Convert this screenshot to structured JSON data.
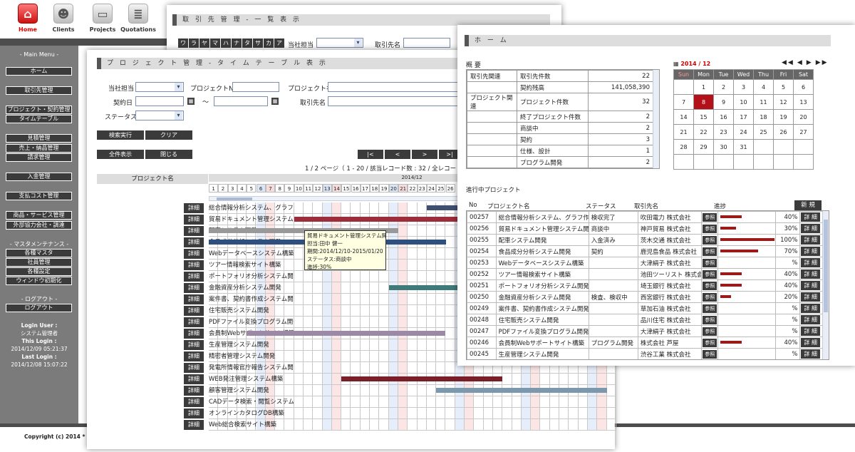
{
  "nav": [
    {
      "label": "Home",
      "icon": "home-icon"
    },
    {
      "label": "Clients",
      "icon": "person-icon"
    },
    {
      "label": "Projects",
      "icon": "folder-icon"
    },
    {
      "label": "Quotations",
      "icon": "document-icon"
    }
  ],
  "sidebar": {
    "main_menu_title": "- Main Menu -",
    "items": [
      "ホーム",
      "取引先管理",
      "プロジェクト・契約管理",
      "タイムテーブル",
      "見積管理",
      "売上・納品管理",
      "請求管理",
      "入金管理",
      "支払コスト管理",
      "商品・サービス管理",
      "外部協力会社・調達"
    ],
    "master_title": "- マスタメンテナンス -",
    "master_items": [
      "各種マスタ",
      "社員管理",
      "各種設定",
      "ウィンドウ初期化"
    ],
    "logout_title": "- ログアウト -",
    "logout_label": "ログアウト",
    "login_user_label": "Login User :",
    "login_user": "システム管理者",
    "this_login_label": "This Login :",
    "this_login": "2014/12/09 05:21:37",
    "last_login_label": "Last Login :",
    "last_login": "2014/12/08 15:07:22"
  },
  "footer": "Copyright (c) 2014 * di",
  "client_window": {
    "title": "取 引 先 管 理 - 一 覧 表 示",
    "kana": [
      "ワ",
      "ラ",
      "ヤ",
      "マ",
      "ハ",
      "ナ",
      "タ",
      "サ",
      "カ",
      "ア"
    ],
    "staff_label": "当社担当",
    "client_label": "取引先名"
  },
  "timetable": {
    "title": "プ ロ ジ ェ ク ト 管 理 - タ イ ム テ ー ブ ル 表 示",
    "filters": {
      "staff": "当社担当",
      "project_no": "プロジェクトNo",
      "project_name": "プロジェクト名",
      "contract_date": "契約日",
      "tilde": "～",
      "client": "取引先名",
      "status": "ステータス"
    },
    "search_label": "検索実行",
    "clear_label": "クリア",
    "show_all_label": "全件表示",
    "close_label": "閉じる",
    "pager": [
      "|<",
      "<",
      ">",
      ">|"
    ],
    "page_info": "1 / 2 ページ（ 1 - 20 / 該当レコード数 : 32 / 全レコード数",
    "col_project": "プロジェクト名",
    "month": "2014/12",
    "days": [
      "1",
      "2",
      "3",
      "4",
      "5",
      "6",
      "7",
      "8",
      "9",
      "10",
      "11",
      "12",
      "13",
      "14",
      "15",
      "16",
      "17",
      "18",
      "19",
      "20",
      "21",
      "22",
      "23",
      "24",
      "25",
      "26"
    ],
    "detail_label": "詳細",
    "projects": [
      "総合情報分析システム、グラフ作",
      "貿易ドキュメント管理システム開発",
      "配車システム開発",
      "食品成分分析システム開発",
      "Webデータベースシステム構築",
      "ツアー情報検索サイト構築",
      "ポートフォリオ分析システム開発",
      "金融資産分析システム開発",
      "案件書、契約書作成システム開発",
      "住宅販売システム開発",
      "PDFファイル変換プログラム開発",
      "会員制Webサポートサイト構築",
      "生産管理システム開発",
      "精密者管理システム開発",
      "発電所情報官庁報告システム開",
      "WEB発注管理システム構築",
      "顧客管理システム開発",
      "CADデータ検索・閲覧システム開",
      "オンラインカタログDB構築",
      "Web総合検索サイト構築"
    ],
    "tooltip": [
      "貿易ドキュメント管理システム開発",
      "担当:田中 健一",
      "期間:2014/12/10-2015/01/20",
      "ステータス:商談中",
      "進捗:30%"
    ]
  },
  "home": {
    "title": "ホ ー ム",
    "summary_title": "概 要",
    "summary": [
      {
        "group": "取引先関連",
        "label": "取引先件数",
        "value": "22"
      },
      {
        "group": "",
        "label": "契約残高",
        "value": "141,058,390"
      },
      {
        "group": "プロジェクト関連",
        "label": "プロジェクト件数",
        "value": "32"
      },
      {
        "group": "",
        "label": "終了プロジェクト件数",
        "value": "2"
      },
      {
        "group": "",
        "label": "商談中",
        "value": "2"
      },
      {
        "group": "",
        "label": "契約",
        "value": "3"
      },
      {
        "group": "",
        "label": "仕様、設計",
        "value": "1"
      },
      {
        "group": "",
        "label": "プログラム開発",
        "value": "2"
      },
      {
        "group": "",
        "label": "検査、検収中",
        "value": ""
      }
    ],
    "calendar": {
      "month": "2014 / 12",
      "nav": [
        "◀◀",
        "◀",
        "▶",
        "▶▶"
      ],
      "weekdays": [
        "Sun",
        "Mon",
        "Tue",
        "Wed",
        "Thu",
        "Fri",
        "Sat"
      ],
      "weeks": [
        [
          "",
          "1",
          "2",
          "3",
          "4",
          "5",
          "6"
        ],
        [
          "7",
          "8",
          "9",
          "10",
          "11",
          "12",
          "13"
        ],
        [
          "14",
          "15",
          "16",
          "17",
          "18",
          "19",
          "20"
        ],
        [
          "21",
          "22",
          "23",
          "24",
          "25",
          "26",
          "27"
        ],
        [
          "28",
          "29",
          "30",
          "31",
          "",
          "",
          ""
        ],
        [
          "",
          "",
          "",
          "",
          "",
          "",
          ""
        ]
      ],
      "today": "8"
    },
    "progress_title": "進行中プロジェクト",
    "cols": {
      "no": "No",
      "name": "プロジェクト名",
      "status": "ステータス",
      "client": "取引先名",
      "progress": "進捗",
      "new": "新 規"
    },
    "ref_label": "参照",
    "detail_label": "詳 細",
    "rows": [
      {
        "no": "00257",
        "name": "総合情報分析システム、グラフ作",
        "status": "検収完了",
        "client": "吹田電力 株式会社",
        "pct": "40%",
        "p": 40
      },
      {
        "no": "00256",
        "name": "貿易ドキュメント管理システム開",
        "status": "商談中",
        "client": "神戸貿易 株式会社",
        "pct": "30%",
        "p": 30
      },
      {
        "no": "00255",
        "name": "配車システム開発",
        "status": "入金済み",
        "client": "茨木交通 株式会社",
        "pct": "100%",
        "p": 100
      },
      {
        "no": "00254",
        "name": "食品成分分析システム開発",
        "status": "契約",
        "client": "鹿児島食品 株式会社",
        "pct": "70%",
        "p": 70
      },
      {
        "no": "00253",
        "name": "Webデータベースシステム構築",
        "status": "",
        "client": "大津絹子 株式会社",
        "pct": "%",
        "p": 0
      },
      {
        "no": "00252",
        "name": "ツアー情報検索サイト構築",
        "status": "",
        "client": "池田ツーリスト 株式会社",
        "pct": "40%",
        "p": 40
      },
      {
        "no": "00251",
        "name": "ポートフォリオ分析システム開発",
        "status": "",
        "client": "埼玉銀行 株式会社",
        "pct": "40%",
        "p": 40
      },
      {
        "no": "00250",
        "name": "金融資産分析システム開発",
        "status": "検査、検収中",
        "client": "西宮銀行 株式会社",
        "pct": "20%",
        "p": 20
      },
      {
        "no": "00249",
        "name": "案件書、契約書作成システム開発",
        "status": "",
        "client": "草加石油 株式会社",
        "pct": "%",
        "p": 0
      },
      {
        "no": "00248",
        "name": "住宅販売システム開発",
        "status": "",
        "client": "品川住宅 株式会社",
        "pct": "%",
        "p": 0
      },
      {
        "no": "00247",
        "name": "PDFファイル変換プログラム開発",
        "status": "",
        "client": "大津絹子 株式会社",
        "pct": "%",
        "p": 0
      },
      {
        "no": "00246",
        "name": "会員制Webサポートサイト構築",
        "status": "プログラム開発",
        "client": "株式会社 芦屋",
        "pct": "40%",
        "p": 40
      },
      {
        "no": "00245",
        "name": "生産管理システム開発",
        "status": "",
        "client": "渋谷工業 株式会社",
        "pct": "%",
        "p": 0
      }
    ]
  }
}
